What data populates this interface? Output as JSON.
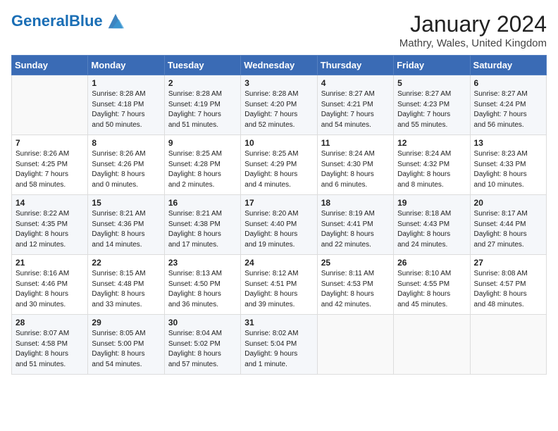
{
  "header": {
    "logo_general": "General",
    "logo_blue": "Blue",
    "month_title": "January 2024",
    "location": "Mathry, Wales, United Kingdom"
  },
  "days_of_week": [
    "Sunday",
    "Monday",
    "Tuesday",
    "Wednesday",
    "Thursday",
    "Friday",
    "Saturday"
  ],
  "weeks": [
    [
      {
        "day": "",
        "lines": []
      },
      {
        "day": "1",
        "lines": [
          "Sunrise: 8:28 AM",
          "Sunset: 4:18 PM",
          "Daylight: 7 hours",
          "and 50 minutes."
        ]
      },
      {
        "day": "2",
        "lines": [
          "Sunrise: 8:28 AM",
          "Sunset: 4:19 PM",
          "Daylight: 7 hours",
          "and 51 minutes."
        ]
      },
      {
        "day": "3",
        "lines": [
          "Sunrise: 8:28 AM",
          "Sunset: 4:20 PM",
          "Daylight: 7 hours",
          "and 52 minutes."
        ]
      },
      {
        "day": "4",
        "lines": [
          "Sunrise: 8:27 AM",
          "Sunset: 4:21 PM",
          "Daylight: 7 hours",
          "and 54 minutes."
        ]
      },
      {
        "day": "5",
        "lines": [
          "Sunrise: 8:27 AM",
          "Sunset: 4:23 PM",
          "Daylight: 7 hours",
          "and 55 minutes."
        ]
      },
      {
        "day": "6",
        "lines": [
          "Sunrise: 8:27 AM",
          "Sunset: 4:24 PM",
          "Daylight: 7 hours",
          "and 56 minutes."
        ]
      }
    ],
    [
      {
        "day": "7",
        "lines": [
          "Sunrise: 8:26 AM",
          "Sunset: 4:25 PM",
          "Daylight: 7 hours",
          "and 58 minutes."
        ]
      },
      {
        "day": "8",
        "lines": [
          "Sunrise: 8:26 AM",
          "Sunset: 4:26 PM",
          "Daylight: 8 hours",
          "and 0 minutes."
        ]
      },
      {
        "day": "9",
        "lines": [
          "Sunrise: 8:25 AM",
          "Sunset: 4:28 PM",
          "Daylight: 8 hours",
          "and 2 minutes."
        ]
      },
      {
        "day": "10",
        "lines": [
          "Sunrise: 8:25 AM",
          "Sunset: 4:29 PM",
          "Daylight: 8 hours",
          "and 4 minutes."
        ]
      },
      {
        "day": "11",
        "lines": [
          "Sunrise: 8:24 AM",
          "Sunset: 4:30 PM",
          "Daylight: 8 hours",
          "and 6 minutes."
        ]
      },
      {
        "day": "12",
        "lines": [
          "Sunrise: 8:24 AM",
          "Sunset: 4:32 PM",
          "Daylight: 8 hours",
          "and 8 minutes."
        ]
      },
      {
        "day": "13",
        "lines": [
          "Sunrise: 8:23 AM",
          "Sunset: 4:33 PM",
          "Daylight: 8 hours",
          "and 10 minutes."
        ]
      }
    ],
    [
      {
        "day": "14",
        "lines": [
          "Sunrise: 8:22 AM",
          "Sunset: 4:35 PM",
          "Daylight: 8 hours",
          "and 12 minutes."
        ]
      },
      {
        "day": "15",
        "lines": [
          "Sunrise: 8:21 AM",
          "Sunset: 4:36 PM",
          "Daylight: 8 hours",
          "and 14 minutes."
        ]
      },
      {
        "day": "16",
        "lines": [
          "Sunrise: 8:21 AM",
          "Sunset: 4:38 PM",
          "Daylight: 8 hours",
          "and 17 minutes."
        ]
      },
      {
        "day": "17",
        "lines": [
          "Sunrise: 8:20 AM",
          "Sunset: 4:40 PM",
          "Daylight: 8 hours",
          "and 19 minutes."
        ]
      },
      {
        "day": "18",
        "lines": [
          "Sunrise: 8:19 AM",
          "Sunset: 4:41 PM",
          "Daylight: 8 hours",
          "and 22 minutes."
        ]
      },
      {
        "day": "19",
        "lines": [
          "Sunrise: 8:18 AM",
          "Sunset: 4:43 PM",
          "Daylight: 8 hours",
          "and 24 minutes."
        ]
      },
      {
        "day": "20",
        "lines": [
          "Sunrise: 8:17 AM",
          "Sunset: 4:44 PM",
          "Daylight: 8 hours",
          "and 27 minutes."
        ]
      }
    ],
    [
      {
        "day": "21",
        "lines": [
          "Sunrise: 8:16 AM",
          "Sunset: 4:46 PM",
          "Daylight: 8 hours",
          "and 30 minutes."
        ]
      },
      {
        "day": "22",
        "lines": [
          "Sunrise: 8:15 AM",
          "Sunset: 4:48 PM",
          "Daylight: 8 hours",
          "and 33 minutes."
        ]
      },
      {
        "day": "23",
        "lines": [
          "Sunrise: 8:13 AM",
          "Sunset: 4:50 PM",
          "Daylight: 8 hours",
          "and 36 minutes."
        ]
      },
      {
        "day": "24",
        "lines": [
          "Sunrise: 8:12 AM",
          "Sunset: 4:51 PM",
          "Daylight: 8 hours",
          "and 39 minutes."
        ]
      },
      {
        "day": "25",
        "lines": [
          "Sunrise: 8:11 AM",
          "Sunset: 4:53 PM",
          "Daylight: 8 hours",
          "and 42 minutes."
        ]
      },
      {
        "day": "26",
        "lines": [
          "Sunrise: 8:10 AM",
          "Sunset: 4:55 PM",
          "Daylight: 8 hours",
          "and 45 minutes."
        ]
      },
      {
        "day": "27",
        "lines": [
          "Sunrise: 8:08 AM",
          "Sunset: 4:57 PM",
          "Daylight: 8 hours",
          "and 48 minutes."
        ]
      }
    ],
    [
      {
        "day": "28",
        "lines": [
          "Sunrise: 8:07 AM",
          "Sunset: 4:58 PM",
          "Daylight: 8 hours",
          "and 51 minutes."
        ]
      },
      {
        "day": "29",
        "lines": [
          "Sunrise: 8:05 AM",
          "Sunset: 5:00 PM",
          "Daylight: 8 hours",
          "and 54 minutes."
        ]
      },
      {
        "day": "30",
        "lines": [
          "Sunrise: 8:04 AM",
          "Sunset: 5:02 PM",
          "Daylight: 8 hours",
          "and 57 minutes."
        ]
      },
      {
        "day": "31",
        "lines": [
          "Sunrise: 8:02 AM",
          "Sunset: 5:04 PM",
          "Daylight: 9 hours",
          "and 1 minute."
        ]
      },
      {
        "day": "",
        "lines": []
      },
      {
        "day": "",
        "lines": []
      },
      {
        "day": "",
        "lines": []
      }
    ]
  ]
}
